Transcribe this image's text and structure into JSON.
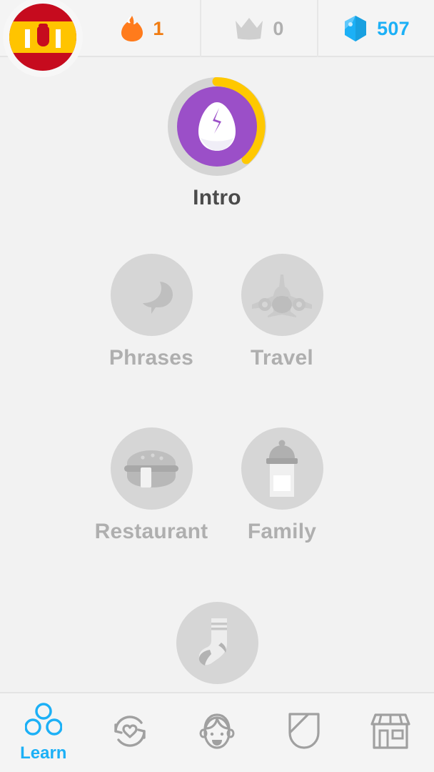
{
  "header": {
    "flag": {
      "name": "spain-flag",
      "alt": "Spanish course flag"
    },
    "stats": [
      {
        "icon": "flame-icon",
        "name": "streak-counter",
        "value": "1",
        "color": "#f07c12"
      },
      {
        "icon": "crown-icon",
        "name": "crown-counter",
        "value": "0",
        "color": "#c8c8c8"
      },
      {
        "icon": "gem-icon",
        "name": "gem-counter",
        "value": "507",
        "color": "#1cb0f6"
      }
    ]
  },
  "tree": {
    "skills": [
      {
        "label": "Intro",
        "icon": "egg-icon",
        "state": "active",
        "ring_color": "#d4d4d4",
        "progress_color": "#ffc800",
        "inner_color": "#9b4fc8",
        "progress_percent": 42
      },
      {
        "label": "Phrases",
        "icon": "speech-bubbles-icon",
        "state": "locked"
      },
      {
        "label": "Travel",
        "icon": "airplane-icon",
        "state": "locked"
      },
      {
        "label": "Restaurant",
        "icon": "burger-icon",
        "state": "locked"
      },
      {
        "label": "Family",
        "icon": "baby-bottle-icon",
        "state": "locked"
      },
      {
        "label": "",
        "icon": "sock-icon",
        "state": "locked"
      }
    ]
  },
  "navbar": {
    "items": [
      {
        "label": "Learn",
        "icon": "learn-circles-icon",
        "name": "nav-learn",
        "active": true
      },
      {
        "label": "",
        "icon": "practice-heart-icon",
        "name": "nav-practice",
        "active": false
      },
      {
        "label": "",
        "icon": "profile-face-icon",
        "name": "nav-profile",
        "active": false
      },
      {
        "label": "",
        "icon": "shield-icon",
        "name": "nav-leaderboard",
        "active": false
      },
      {
        "label": "",
        "icon": "shop-icon",
        "name": "nav-shop",
        "active": false
      }
    ],
    "active_color": "#1cb0f6",
    "inactive_color": "#afafaf"
  }
}
